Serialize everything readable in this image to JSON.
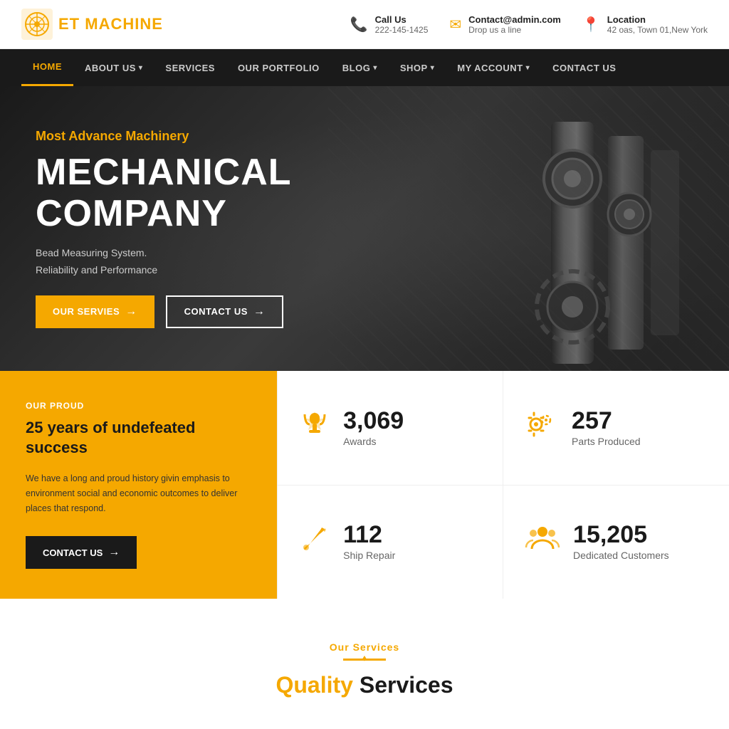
{
  "site": {
    "logo_text_1": "ET",
    "logo_text_2": "MACHINE"
  },
  "topbar": {
    "phone_label": "Call Us",
    "phone_value": "222-145-1425",
    "email_label": "Contact@admin.com",
    "email_desc": "Drop us a line",
    "location_label": "Location",
    "location_value": "42 oas, Town 01,New York"
  },
  "nav": {
    "items": [
      {
        "label": "HOME",
        "active": true,
        "has_dropdown": false
      },
      {
        "label": "ABOUT US",
        "active": false,
        "has_dropdown": true
      },
      {
        "label": "SERVICES",
        "active": false,
        "has_dropdown": false
      },
      {
        "label": "OUR PORTFOLIO",
        "active": false,
        "has_dropdown": false
      },
      {
        "label": "BLOG",
        "active": false,
        "has_dropdown": true
      },
      {
        "label": "SHOP",
        "active": false,
        "has_dropdown": true
      },
      {
        "label": "MY ACCOUNT",
        "active": false,
        "has_dropdown": true
      },
      {
        "label": "CONTACT US",
        "active": false,
        "has_dropdown": false
      }
    ]
  },
  "hero": {
    "subtitle": "Most Advance Machinery",
    "title": "MECHANICAL COMPANY",
    "desc1": "Bead Measuring System.",
    "desc2": "Reliability and Performance",
    "btn_services": "Our Servies",
    "btn_contact": "Contact Us"
  },
  "stats_section": {
    "our_proud": "Our proud",
    "heading": "25 years of undefeated success",
    "description": "We have a long and proud history givin emphasis to environment social and economic outcomes to deliver places that respond.",
    "btn_label": "Contact Us",
    "stats": [
      {
        "number": "3,069",
        "label": "Awards",
        "icon": "trophy"
      },
      {
        "number": "257",
        "label": "Parts Produced",
        "icon": "gear"
      },
      {
        "number": "112",
        "label": "Ship Repair",
        "icon": "wrench"
      },
      {
        "number": "15,205",
        "label": "Dedicated Customers",
        "icon": "users"
      }
    ]
  },
  "services_section": {
    "label": "Our Services",
    "title_part1": "Quality",
    "title_part2": " Services"
  },
  "colors": {
    "primary": "#f5a800",
    "dark": "#1a1a1a",
    "gray": "#666666"
  }
}
